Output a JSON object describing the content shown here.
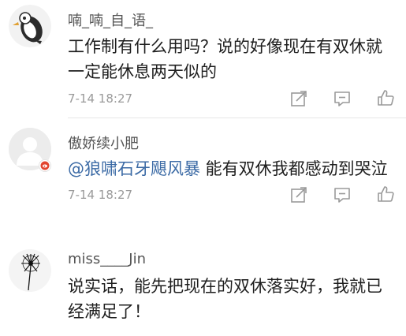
{
  "comments": [
    {
      "username": "喃_喃_自_语_",
      "lines": [
        "工作制有什么用吗？说的好像现在有双休就",
        "一定能休息两天似的"
      ],
      "time": "7-14 18:27",
      "avatar_icon": "penguin-doodle-avatar"
    },
    {
      "username": "傲娇续小肥",
      "mention": "@狼啸石牙飓风暴",
      "text": " 能有双休我都感动到哭泣",
      "time": "7-14 18:27",
      "avatar_icon": "default-user-avatar",
      "badge_icon": "weibo-badge-icon"
    },
    {
      "username": "miss____Jin",
      "lines": [
        "说实话，能先把现在的双休落实好，我就已",
        "经满足了！"
      ],
      "avatar_icon": "ink-dandelion-avatar"
    }
  ],
  "colors": {
    "mention": "#3b6aa5",
    "muted": "#9a9a9a",
    "icon": "#9a9a9a",
    "badge": "#e2452f"
  }
}
